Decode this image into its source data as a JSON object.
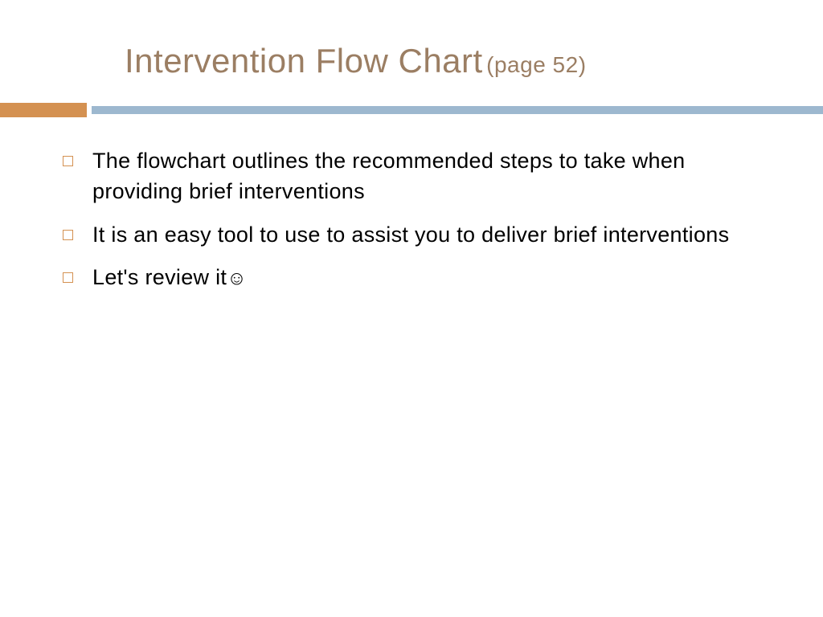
{
  "title": {
    "main": "Intervention Flow Chart",
    "sub": "(page 52)"
  },
  "bullets": {
    "0": "The flowchart outlines the recommended steps to take when providing brief interventions",
    "1": "It is an easy tool to use to assist you to deliver brief interventions",
    "2": "Let's review it",
    "2_icon": "☺"
  },
  "colors": {
    "title": "#9b7e63",
    "accent_orange": "#d49151",
    "accent_blue": "#9db8cf"
  }
}
